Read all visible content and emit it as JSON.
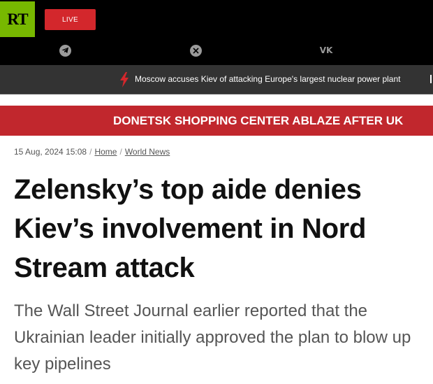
{
  "header": {
    "logo_text": "RT",
    "live_label": "LIVE",
    "social_icons": [
      "telegram-icon",
      "x-icon",
      "vk-icon"
    ],
    "vk_text": "VK"
  },
  "ticker": {
    "text": "Moscow accuses Kiev of attacking Europe's largest nuclear power plant",
    "bolt_color": "#d3272c"
  },
  "banner": {
    "text": "DONETSK SHOPPING CENTER ABLAZE AFTER UK"
  },
  "article": {
    "date": "15 Aug, 2024 15:08",
    "breadcrumbs": [
      "Home",
      "World News"
    ],
    "title": "Zelensky’s top aide denies Kiev’s involvement in Nord Stream attack",
    "summary": "The Wall Street Journal earlier reported that the Ukrainian leader initially approved the plan to blow up key pipelines"
  },
  "colors": {
    "brand_green": "#77b800",
    "accent_red": "#c1272d",
    "ticker_bg": "#333333"
  }
}
